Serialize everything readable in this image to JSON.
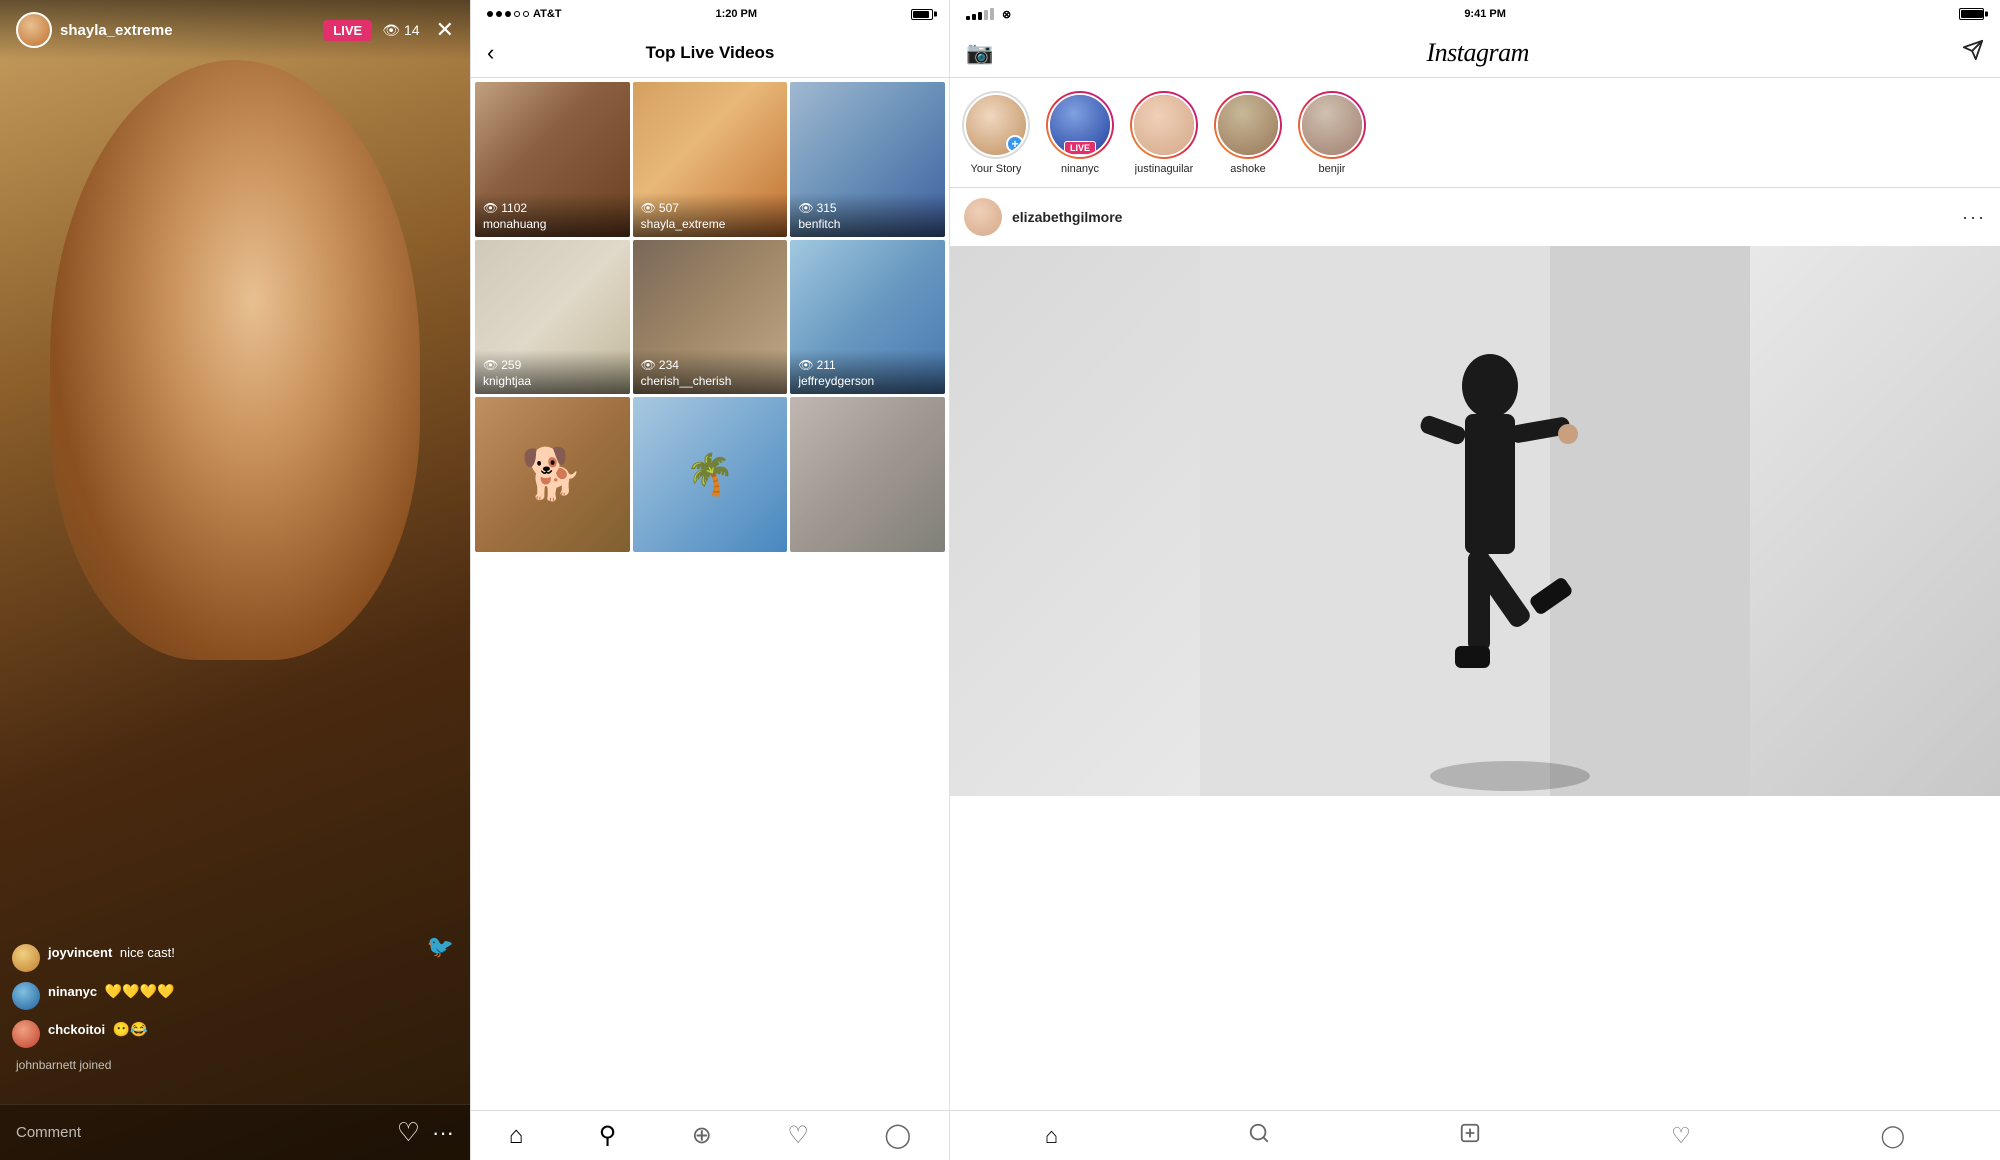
{
  "panel1": {
    "username": "shayla_extreme",
    "live_label": "LIVE",
    "viewer_count": "14",
    "comments": [
      {
        "avatar_class": "av1",
        "username": "joyvincent",
        "text": "nice cast!",
        "emoji": ""
      },
      {
        "avatar_class": "av2",
        "username": "ninanyc",
        "text": "",
        "emoji": "💛💛💛💛"
      },
      {
        "avatar_class": "av3",
        "username": "chckoitoi",
        "text": "",
        "emoji": "😶😂"
      }
    ],
    "joined_notice": "johnbarnett joined",
    "comment_placeholder": "Comment"
  },
  "panel2": {
    "status": {
      "carrier": "AT&T",
      "time": "1:20 PM"
    },
    "title": "Top Live Videos",
    "grid": [
      [
        {
          "id": "monahuang",
          "views": "1102",
          "username": "monahuang",
          "thumb_class": "thumb-monahuang"
        },
        {
          "id": "shayla_extreme",
          "views": "507",
          "username": "shayla_extreme",
          "thumb_class": "thumb-shayla"
        },
        {
          "id": "benfitch",
          "views": "315",
          "username": "benfitch",
          "thumb_class": "thumb-benfitch"
        }
      ],
      [
        {
          "id": "knightjaa",
          "views": "259",
          "username": "knightjaa",
          "thumb_class": "thumb-knightjaa"
        },
        {
          "id": "cherish__cherish",
          "views": "234",
          "username": "cherish__cherish",
          "thumb_class": "thumb-cherish"
        },
        {
          "id": "jeffreydgerson",
          "views": "211",
          "username": "jeffreydgerson",
          "thumb_class": "thumb-jeffreydg"
        }
      ],
      [
        {
          "id": "dog-user",
          "views": "",
          "username": "",
          "thumb_class": "thumb-dog"
        },
        {
          "id": "palms-user",
          "views": "",
          "username": "",
          "thumb_class": "thumb-palms"
        },
        {
          "id": "selfie-user",
          "views": "",
          "username": "",
          "thumb_class": "thumb-selfie"
        }
      ]
    ]
  },
  "panel3": {
    "status": {
      "time": "9:41 PM"
    },
    "logo": "Instagram",
    "stories": [
      {
        "label": "Your Story",
        "avatar_class": "story-avatar-your",
        "has_gradient": false,
        "live": false
      },
      {
        "label": "ninanyc",
        "avatar_class": "story-avatar-nina",
        "has_gradient": true,
        "live": true
      },
      {
        "label": "justinaguilar",
        "avatar_class": "story-avatar-justin",
        "has_gradient": true,
        "live": false
      },
      {
        "label": "ashoke",
        "avatar_class": "story-avatar-ashoke",
        "has_gradient": true,
        "live": false
      },
      {
        "label": "benjir",
        "avatar_class": "story-avatar-benjir",
        "has_gradient": true,
        "live": false
      }
    ],
    "post": {
      "username": "elizabethgilmore",
      "more_icon": "···"
    }
  }
}
